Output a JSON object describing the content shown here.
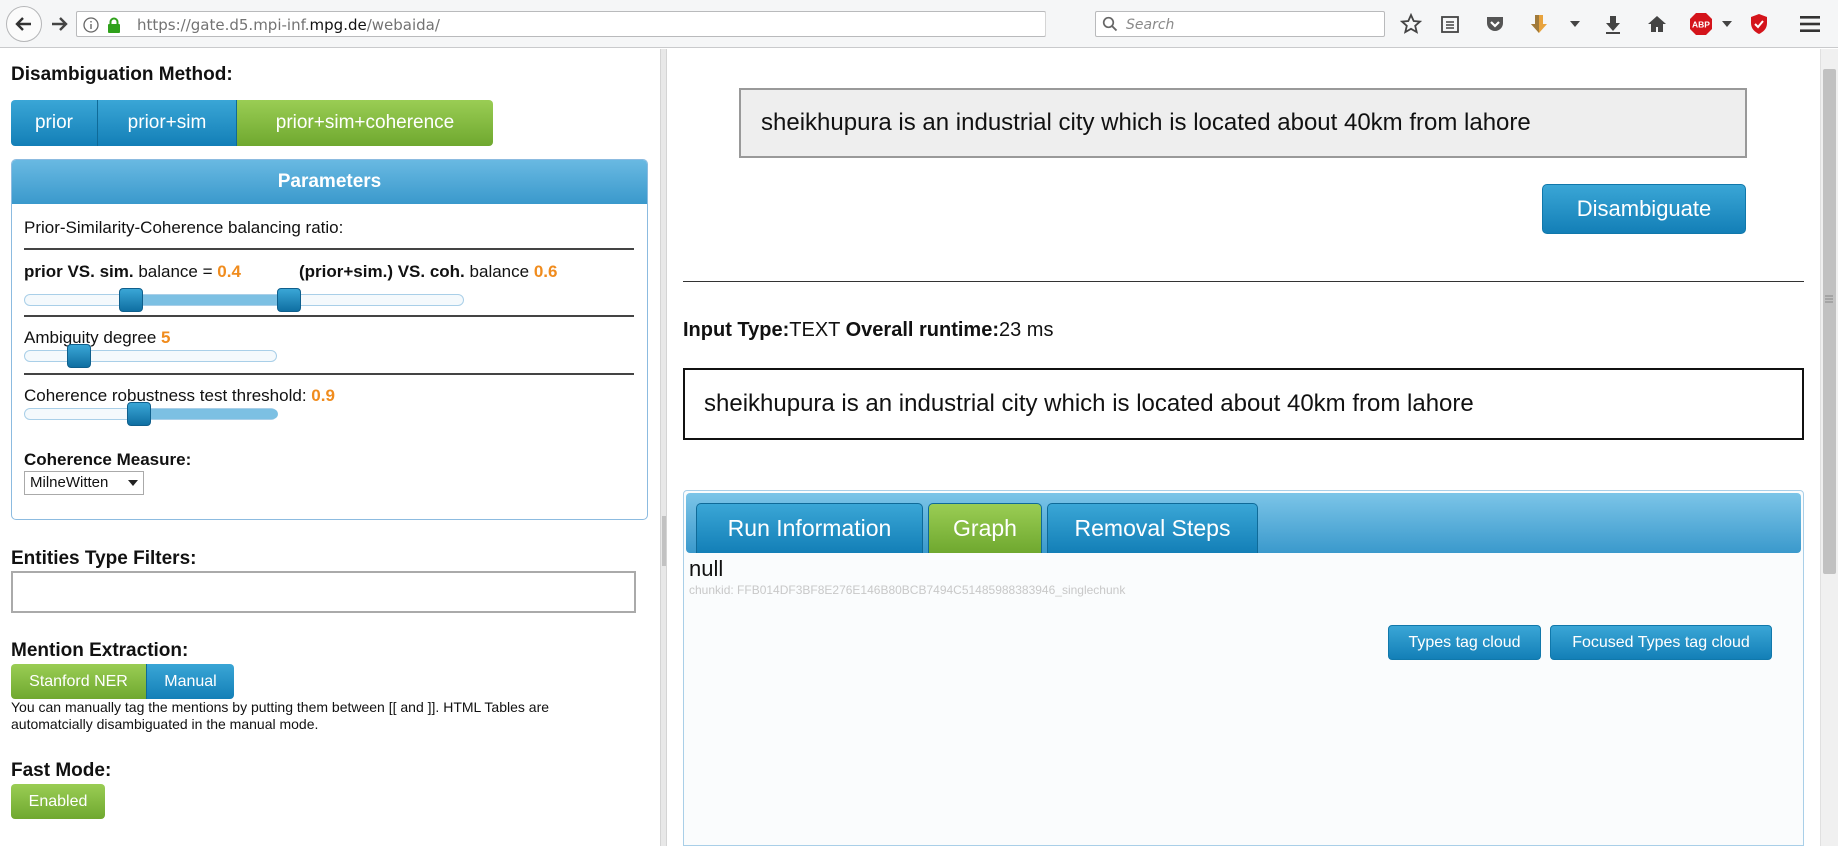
{
  "browser": {
    "url_prefix": "https://gate.d5.mpi-inf.",
    "url_domain": "mpg.de",
    "url_suffix": "/webaida/",
    "search_placeholder": "Search"
  },
  "left": {
    "disambiguation_heading": "Disambiguation Method:",
    "methods": [
      {
        "label": "prior",
        "selected": false
      },
      {
        "label": "prior+sim",
        "selected": false
      },
      {
        "label": "prior+sim+coherence",
        "selected": true
      }
    ],
    "parameters": {
      "title": "Parameters",
      "balancing_label": "Prior-Similarity-Coherence balancing ratio:",
      "prior_vs_sim_bold": "prior VS. sim.",
      "prior_vs_sim_rest": "balance =",
      "prior_vs_sim_value": "0.4",
      "priorsim_vs_coh_bold": "(prior+sim.) VS. coh.",
      "priorsim_vs_coh_rest": "balance",
      "priorsim_vs_coh_value": "0.6",
      "ambiguity_label": "Ambiguity degree",
      "ambiguity_value": "5",
      "coherence_threshold_label": "Coherence robustness test threshold:",
      "coherence_threshold_value": "0.9",
      "coherence_measure_label": "Coherence Measure:",
      "coherence_measure_selected": "MilneWitten"
    },
    "entities_filter_heading": "Entities Type Filters:",
    "entities_filter_value": "",
    "mention_extraction_heading": "Mention Extraction:",
    "mention_buttons": [
      {
        "label": "Stanford NER",
        "selected": true
      },
      {
        "label": "Manual",
        "selected": false
      }
    ],
    "manual_note_line1": "You can manually tag the mentions by putting them between [[ and ]]. HTML Tables are",
    "manual_note_line2": "automatcially disambiguated in the manual mode.",
    "fast_mode_heading": "Fast Mode:",
    "fast_mode_button": "Enabled"
  },
  "right": {
    "input_text": "sheikhupura is an industrial city which is located about 40km from lahore",
    "disambiguate_button": "Disambiguate",
    "input_type_label": "Input Type:",
    "input_type_value": "TEXT",
    "runtime_label": "Overall runtime:",
    "runtime_value": "23 ms",
    "result_text": "sheikhupura is an industrial city which is located about 40km from lahore",
    "tabs": [
      {
        "label": "Run Information",
        "active": false
      },
      {
        "label": "Graph",
        "active": true
      },
      {
        "label": "Removal Steps",
        "active": false
      }
    ],
    "graph_value": "null",
    "chunk_id_text": "chunkid: FFB014DF3BF8E276E146B80BCB7494C51485988383946_singlechunk",
    "types_tag_cloud_button": "Types tag cloud",
    "focused_types_tag_cloud_button": "Focused Types tag cloud"
  },
  "colors": {
    "accent_blue": "#137fb7",
    "accent_green": "#6fa82f",
    "value_orange": "#f08c1e"
  }
}
